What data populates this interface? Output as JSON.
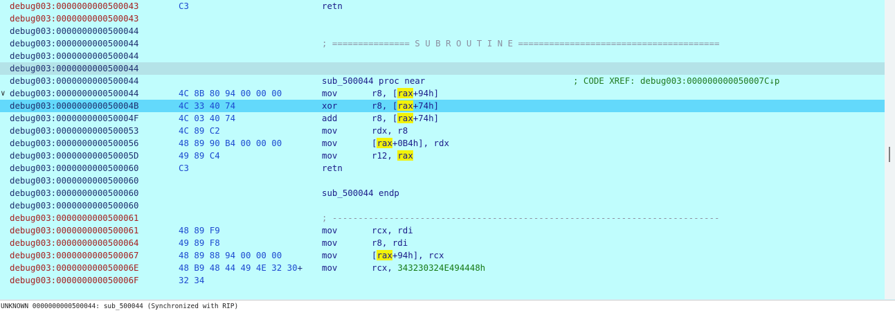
{
  "rows": [
    {
      "addr": "debug003:0000000000500043",
      "addr_color": "red",
      "bytes": "C3",
      "mnem": "retn"
    },
    {
      "addr": "debug003:0000000000500043",
      "addr_color": "red"
    },
    {
      "addr": "debug003:0000000000500044",
      "addr_color": "black"
    },
    {
      "addr": "debug003:0000000000500044",
      "addr_color": "black",
      "sep": "; =============== S U B R O U T I N E ======================================="
    },
    {
      "addr": "debug003:0000000000500044",
      "addr_color": "black"
    },
    {
      "addr": "debug003:0000000000500044",
      "addr_color": "black",
      "style": "curline"
    },
    {
      "addr": "debug003:0000000000500044",
      "addr_color": "black",
      "label": "sub_500044 proc near",
      "comment": "; CODE XREF: debug003:000000000050007C↓p"
    },
    {
      "addr": "debug003:0000000000500044",
      "addr_color": "black",
      "arrow": "∨",
      "bytes": "4C 8B 80 94 00 00 00",
      "mnem": "mov",
      "operands": [
        {
          "t": "r8, ["
        },
        {
          "t": "rax",
          "h": true
        },
        {
          "t": "+94h]"
        }
      ]
    },
    {
      "addr": "debug003:000000000050004B",
      "addr_color": "black",
      "bytes": "4C 33 40 74",
      "mnem": "xor",
      "operands": [
        {
          "t": "r8, ["
        },
        {
          "t": "rax",
          "h": true
        },
        {
          "t": "+74h]"
        }
      ],
      "style": "hl"
    },
    {
      "addr": "debug003:000000000050004F",
      "addr_color": "black",
      "bytes": "4C 03 40 74",
      "mnem": "add",
      "operands": [
        {
          "t": "r8, ["
        },
        {
          "t": "rax",
          "h": true
        },
        {
          "t": "+74h]"
        }
      ]
    },
    {
      "addr": "debug003:0000000000500053",
      "addr_color": "black",
      "bytes": "4C 89 C2",
      "mnem": "mov",
      "operands": [
        {
          "t": "rdx, r8"
        }
      ]
    },
    {
      "addr": "debug003:0000000000500056",
      "addr_color": "black",
      "bytes": "48 89 90 B4 00 00 00",
      "mnem": "mov",
      "operands": [
        {
          "t": "["
        },
        {
          "t": "rax",
          "h": true
        },
        {
          "t": "+0B4h], rdx"
        }
      ]
    },
    {
      "addr": "debug003:000000000050005D",
      "addr_color": "black",
      "bytes": "49 89 C4",
      "mnem": "mov",
      "operands": [
        {
          "t": "r12, "
        },
        {
          "t": "rax",
          "h": true
        }
      ]
    },
    {
      "addr": "debug003:0000000000500060",
      "addr_color": "black",
      "bytes": "C3",
      "mnem": "retn"
    },
    {
      "addr": "debug003:0000000000500060",
      "addr_color": "black"
    },
    {
      "addr": "debug003:0000000000500060",
      "addr_color": "black",
      "label": "sub_500044 endp"
    },
    {
      "addr": "debug003:0000000000500060",
      "addr_color": "black"
    },
    {
      "addr": "debug003:0000000000500061",
      "addr_color": "red",
      "sep": "; ---------------------------------------------------------------------------"
    },
    {
      "addr": "debug003:0000000000500061",
      "addr_color": "red",
      "bytes": "48 89 F9",
      "mnem": "mov",
      "operands": [
        {
          "t": "rcx, rdi"
        }
      ]
    },
    {
      "addr": "debug003:0000000000500064",
      "addr_color": "red",
      "bytes": "49 89 F8",
      "mnem": "mov",
      "operands": [
        {
          "t": "r8, rdi"
        }
      ]
    },
    {
      "addr": "debug003:0000000000500067",
      "addr_color": "red",
      "bytes": "48 89 88 94 00 00 00",
      "mnem": "mov",
      "operands": [
        {
          "t": "["
        },
        {
          "t": "rax",
          "h": true
        },
        {
          "t": "+94h], rcx"
        }
      ]
    },
    {
      "addr": "debug003:000000000050006E",
      "addr_color": "red",
      "bytes": "48 B9 48 44 49 4E 32 30",
      "bytes_more": "+",
      "mnem": "mov",
      "operands": [
        {
          "t": "rcx, "
        },
        {
          "t": "343230324E494448h",
          "num": true
        }
      ]
    },
    {
      "addr": "debug003:000000000050006F",
      "addr_color": "red",
      "bytes": "32 34"
    }
  ],
  "status": {
    "text": "UNKNOWN 0000000000500044: sub_500044 (Synchronized with RIP)"
  },
  "colors": {
    "background": "#c0fdfd",
    "current_line": "#b4e3e8",
    "selection": "#63d9fb",
    "register_highlight": "#f2f20a"
  }
}
